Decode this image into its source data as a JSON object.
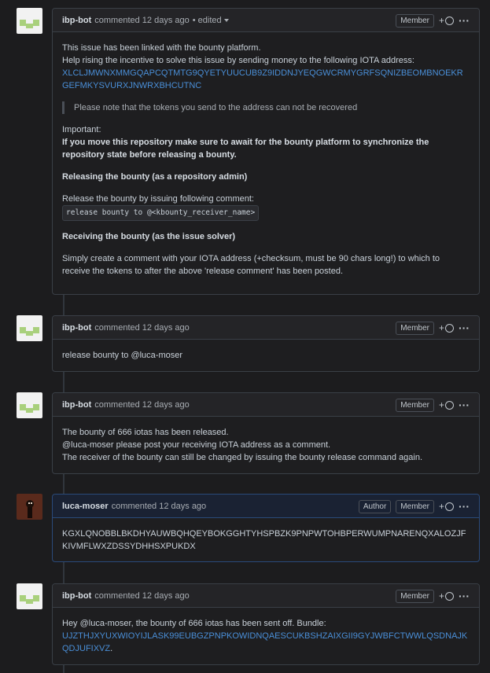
{
  "comments": [
    {
      "user": "ibp-bot",
      "meta": "commented 12 days ago",
      "edited": "• edited",
      "badges": [
        "Member"
      ],
      "body": {
        "p1": "This issue has been linked with the bounty platform.",
        "p2": "Help rising the incentive to solve this issue by sending money to the following IOTA address:",
        "address": "XLCLJMWNXMMGQAPCQTMTG9QYETYUUCUB9Z9IDDNJYEQGWCRMYGRFSQNIZBEOMBNOEKRGEFMKYSVURXJNWRXBHCUTNC",
        "quote": "Please note that the tokens you send to the address can not be recovered",
        "important": "Important:",
        "important_bold": "If you move this repository make sure to await for the bounty platform to synchronize the repository state before releasing a bounty.",
        "h_release": "Releasing the bounty (as a repository admin)",
        "release_text": "Release the bounty by issuing following comment:",
        "release_code": "release bounty to @<kbounty_receiver_name>",
        "h_receive": "Receiving the bounty (as the issue solver)",
        "receive_text": "Simply create a comment with your IOTA address (+checksum, must be 90 chars long!) to which to receive the tokens to after the above 'release comment' has been posted."
      }
    },
    {
      "user": "ibp-bot",
      "meta": "commented 12 days ago",
      "badges": [
        "Member"
      ],
      "body": {
        "text": "release bounty to @luca-moser"
      }
    },
    {
      "user": "ibp-bot",
      "meta": "commented 12 days ago",
      "badges": [
        "Member"
      ],
      "body": {
        "l1": "The bounty of 666 iotas has been released.",
        "l2": "@luca-moser please post your receiving IOTA address as a comment.",
        "l3": "The receiver of the bounty can still be changed by issuing the bounty release command again."
      }
    },
    {
      "user": "luca-moser",
      "meta": "commented 12 days ago",
      "badges": [
        "Author",
        "Member"
      ],
      "body": {
        "address": "KGXLQNOBBLBKDHYAUWBQHQEYBOKGGHTYHSPBZK9PNPWTOHBPERWUMPNARENQXALOZJFKIVMFLWXZDSSYDHHSXPUKDX"
      }
    },
    {
      "user": "ibp-bot",
      "meta": "commented 12 days ago",
      "badges": [
        "Member"
      ],
      "body": {
        "text": "Hey @luca-moser, the bounty of 666 iotas has been sent off. Bundle:",
        "bundle": "UJZTHJXYUXWIOYIJLASK99EUBGZPNPKOWIDNQAESCUKBSHZAIXGII9GYJWBFCTWWLQSDNAJKQDJUFIXVZ",
        "end": "."
      }
    }
  ],
  "icons": {
    "add_reaction": "smiley-plus-icon",
    "more": "kebab-icon"
  },
  "colors": {
    "link": "#4a8fd8",
    "background": "#1c1c1e",
    "border": "#3a3f46",
    "author_border": "#2a4a7a"
  }
}
